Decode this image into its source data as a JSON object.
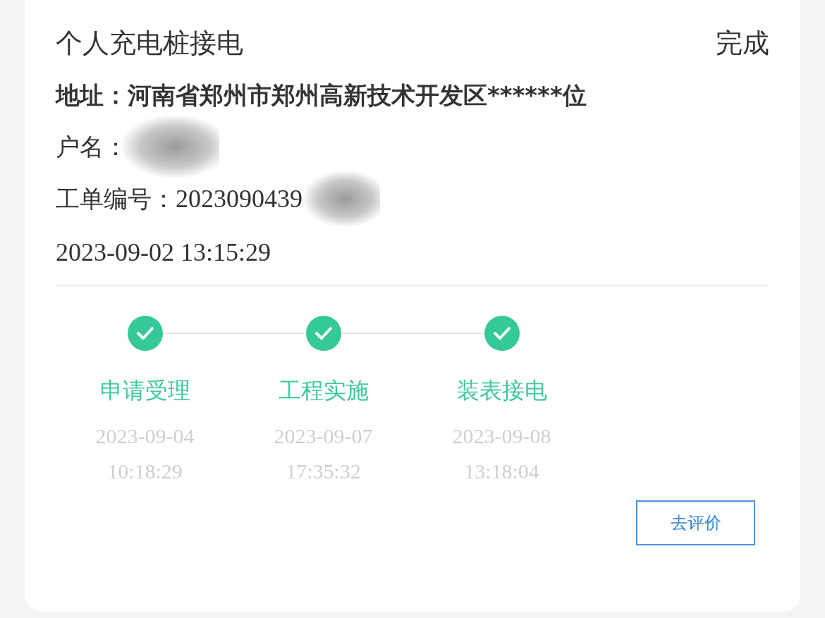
{
  "order": {
    "title": "个人充电桩接电",
    "status": "完成",
    "address_label": "地址：",
    "address": "河南省郑州市郑州高新技术开发区******位",
    "name_label": "户名：",
    "number_label": "工单编号：",
    "number": "2023090439",
    "created": "2023-09-02 13:15:29"
  },
  "steps": [
    {
      "label": "申请受理",
      "date": "2023-09-04",
      "time": "10:18:29",
      "completed": true
    },
    {
      "label": "工程实施",
      "date": "2023-09-07",
      "time": "17:35:32",
      "completed": true
    },
    {
      "label": "装表接电",
      "date": "2023-09-08",
      "time": "13:18:04",
      "completed": true
    }
  ],
  "button": "去评价"
}
